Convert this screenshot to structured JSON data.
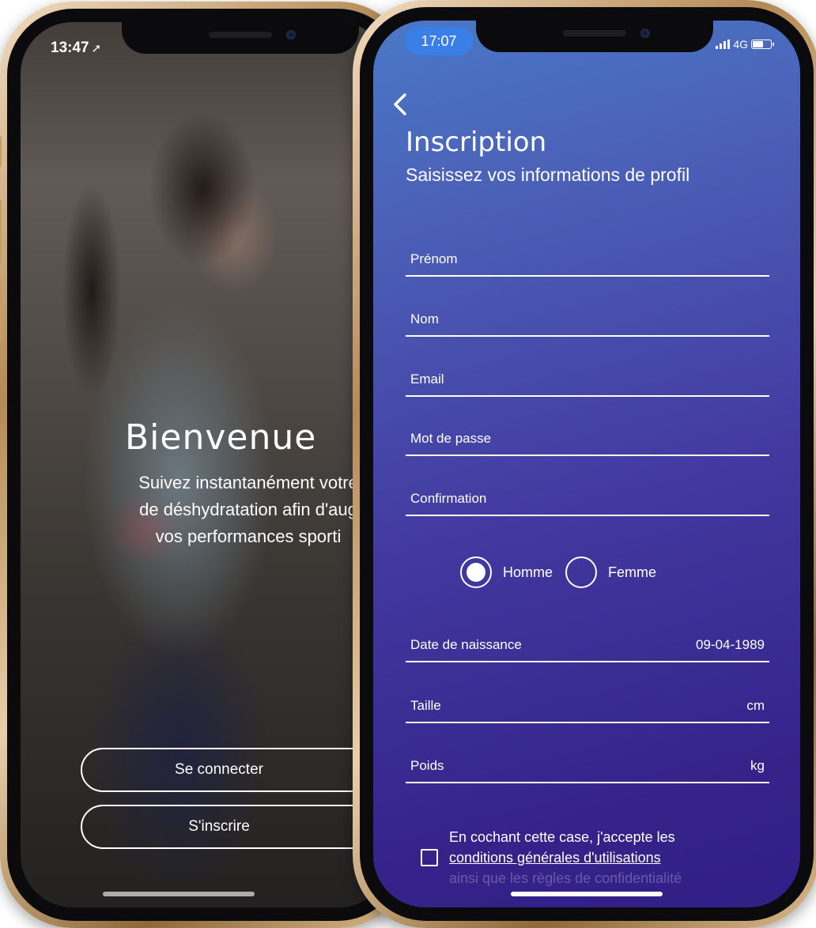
{
  "left_phone": {
    "status_time": "13:47",
    "location_glyph": "➚",
    "welcome_title": "Bienvenue",
    "welcome_lines": [
      "Suivez instantanément votre",
      "de déshydratation afin d'aug",
      "vos performances sporti"
    ],
    "login_label": "Se connecter",
    "signup_label": "S'inscrire"
  },
  "right_phone": {
    "status_time": "17:07",
    "network": "4G",
    "back_glyph": "‹",
    "title": "Inscription",
    "subtitle": "Saisissez vos informations de profil",
    "fields": {
      "first_name": "Prénom",
      "last_name": "Nom",
      "email": "Email",
      "password": "Mot de passe",
      "confirmation": "Confirmation",
      "birth_date_label": "Date de naissance",
      "birth_date_value": "09-04-1989",
      "height_label": "Taille",
      "height_unit": "cm",
      "weight_label": "Poids",
      "weight_unit": "kg"
    },
    "gender": {
      "male": "Homme",
      "female": "Femme",
      "selected": "Homme"
    },
    "terms": {
      "line1": "En cochant cette case, j'accepte les",
      "link": "conditions générales d'utilisations",
      "line3": "ainsi que les règles de confidentialité"
    }
  },
  "colors": {
    "accent_time_pill": "#3a7ee8",
    "gradient_top": "#4a78c6",
    "gradient_bottom": "#301f86",
    "frame_gold": "#c79d66"
  }
}
